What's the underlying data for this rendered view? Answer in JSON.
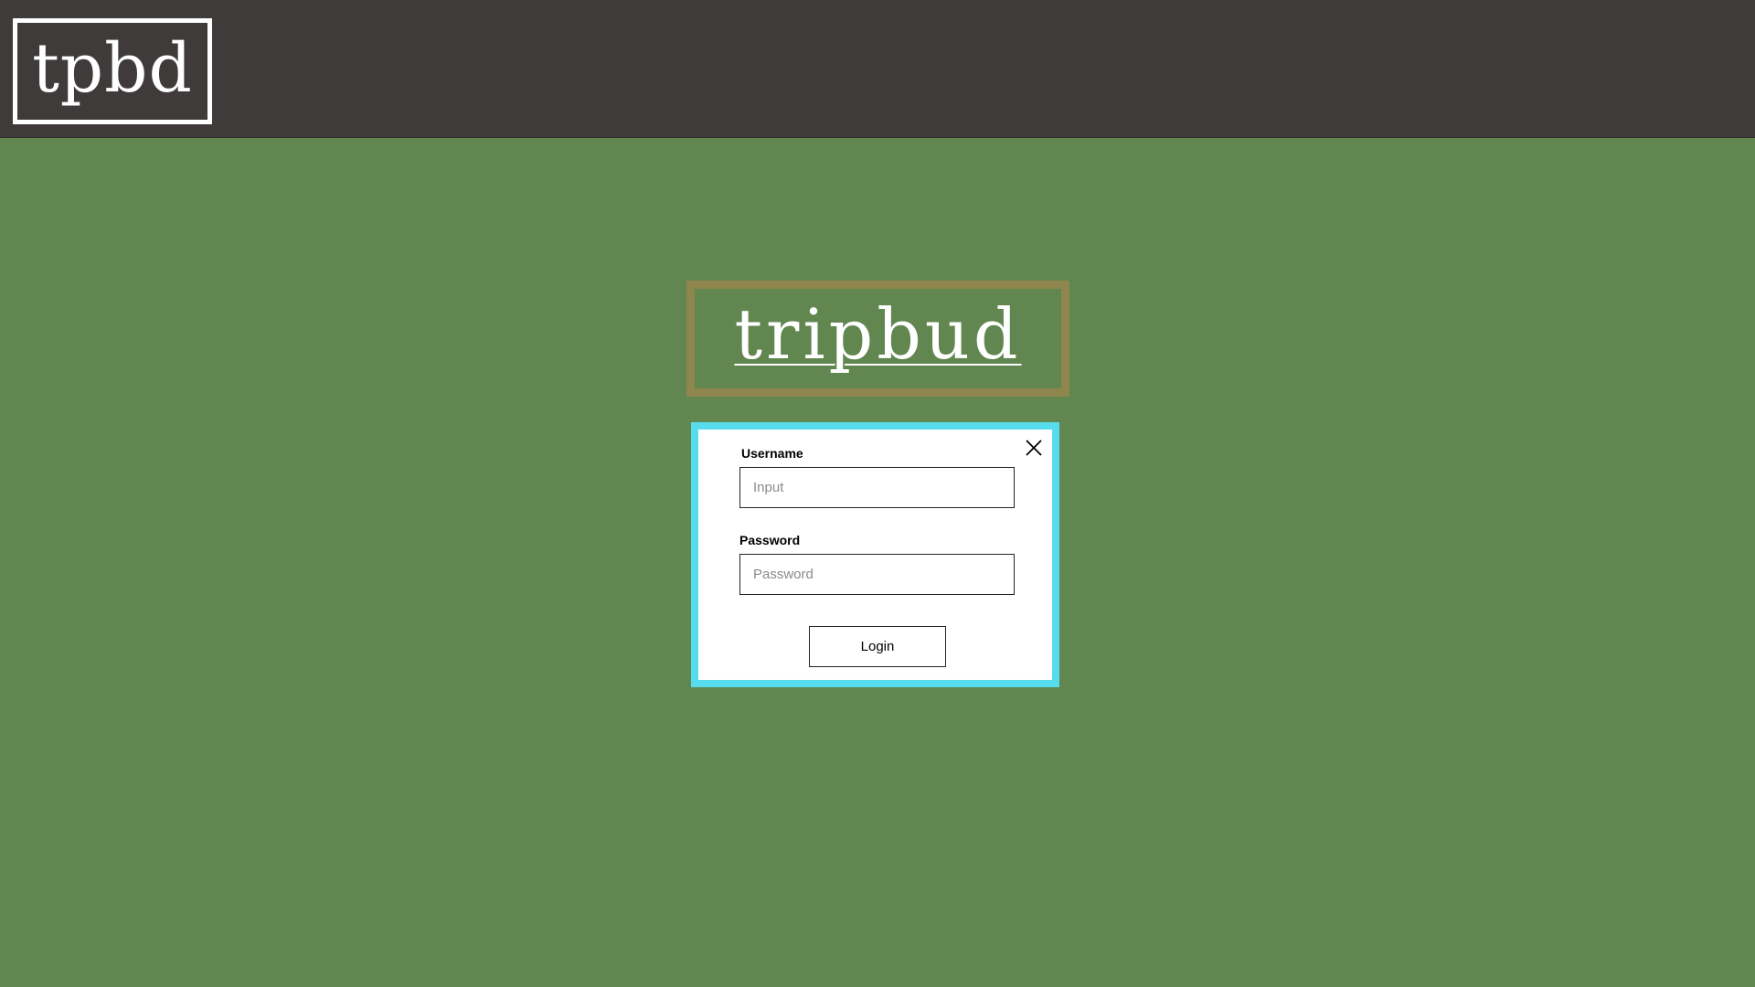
{
  "header": {
    "logo_text": "tpbd"
  },
  "brand": {
    "title": "tripbud"
  },
  "login_modal": {
    "close_icon": "close-icon",
    "username_label": "Username",
    "username_placeholder": "Input",
    "username_value": "",
    "password_label": "Password",
    "password_placeholder": "Password",
    "password_value": "",
    "login_button_label": "Login"
  },
  "colors": {
    "background": "#62864f",
    "header_background": "#3f3b3b",
    "brand_border": "#8f864d",
    "modal_border": "#56dcec",
    "modal_background": "#ffffff"
  }
}
